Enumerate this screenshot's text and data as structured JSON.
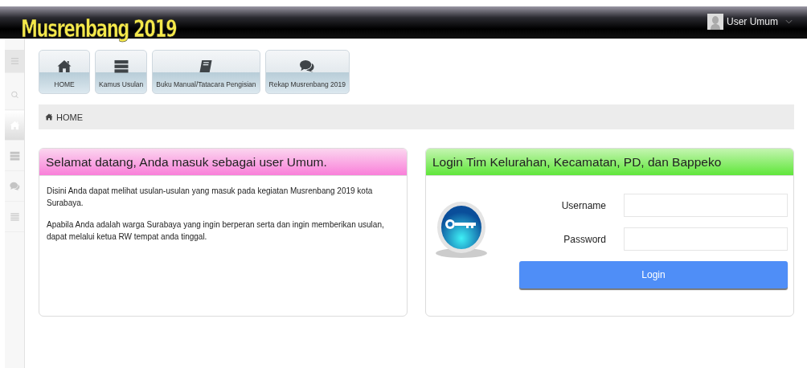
{
  "header": {
    "logo": "Musrenbang 2019",
    "user": {
      "name": "User Umum"
    }
  },
  "sidebar": {
    "items": [
      {
        "kind": "menu",
        "selected": false
      },
      {
        "kind": "search",
        "selected": false
      },
      {
        "kind": "home",
        "selected": true
      },
      {
        "kind": "server",
        "selected": false
      },
      {
        "kind": "chat",
        "selected": false
      },
      {
        "kind": "list",
        "selected": false
      }
    ]
  },
  "nav_buttons": [
    {
      "kind": "home",
      "label": "HOME"
    },
    {
      "kind": "server",
      "label": "Kamus Usulan"
    },
    {
      "kind": "book",
      "label": "Buku Manual/Tatacara Pengisian"
    },
    {
      "kind": "chat",
      "label": "Rekap Musrenbang 2019"
    }
  ],
  "breadcrumb": {
    "label": "HOME"
  },
  "welcome_panel": {
    "title": "Selamat datang, Anda masuk sebagai user Umum.",
    "paragraphs": [
      "Disini Anda dapat melihat usulan-usulan yang masuk pada kegiatan Musrenbang 2019 kota Surabaya.",
      "Apabila Anda adalah warga Surabaya yang ingin berperan serta dan ingin memberikan usulan, dapat melalui ketua RW tempat anda tinggal."
    ]
  },
  "login_panel": {
    "title": "Login Tim Kelurahan, Kecamatan, PD, dan Bappeko",
    "fields": [
      {
        "label": "Username"
      },
      {
        "label": "Password"
      }
    ],
    "button": "Login"
  }
}
